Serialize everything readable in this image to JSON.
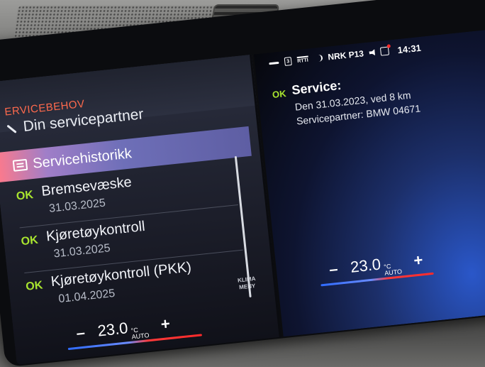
{
  "left_menu": {
    "section_title": "ERVICEBEHOV",
    "service_partner": "Din servicepartner",
    "service_history": "Servicehistorikk",
    "items": [
      {
        "status": "OK",
        "name": "Bremsevæske",
        "date": "31.03.2025"
      },
      {
        "status": "OK",
        "name": "Kjøretøykontroll",
        "date": "31.03.2025"
      },
      {
        "status": "OK",
        "name": "Kjøretøykontroll (PKK)",
        "date": "01.04.2025"
      }
    ]
  },
  "klima_menu": {
    "line1": "KLIMA",
    "line2": "MENY"
  },
  "climate_left": {
    "minus": "–",
    "temp": "23.0",
    "unit_top": "°C",
    "unit_bottom": "AUTO",
    "plus": "+"
  },
  "climate_right": {
    "minus": "–",
    "temp": "23.0",
    "unit_top": "°C",
    "unit_bottom": "AUTO",
    "plus": "+"
  },
  "status_bar": {
    "box_label": "3",
    "rti_label": "RTTI",
    "radio_station": "NRK P13",
    "clock": "14:31"
  },
  "service_detail": {
    "status": "OK",
    "title": "Service:",
    "line1": "Den 31.03.2023, ved 8 km",
    "line2": "Servicepartner: BMW 04671"
  },
  "colors": {
    "ok_green": "#a9e52f",
    "section_title_red": "#ff6a4d",
    "highlight": "#6e6fb8"
  }
}
